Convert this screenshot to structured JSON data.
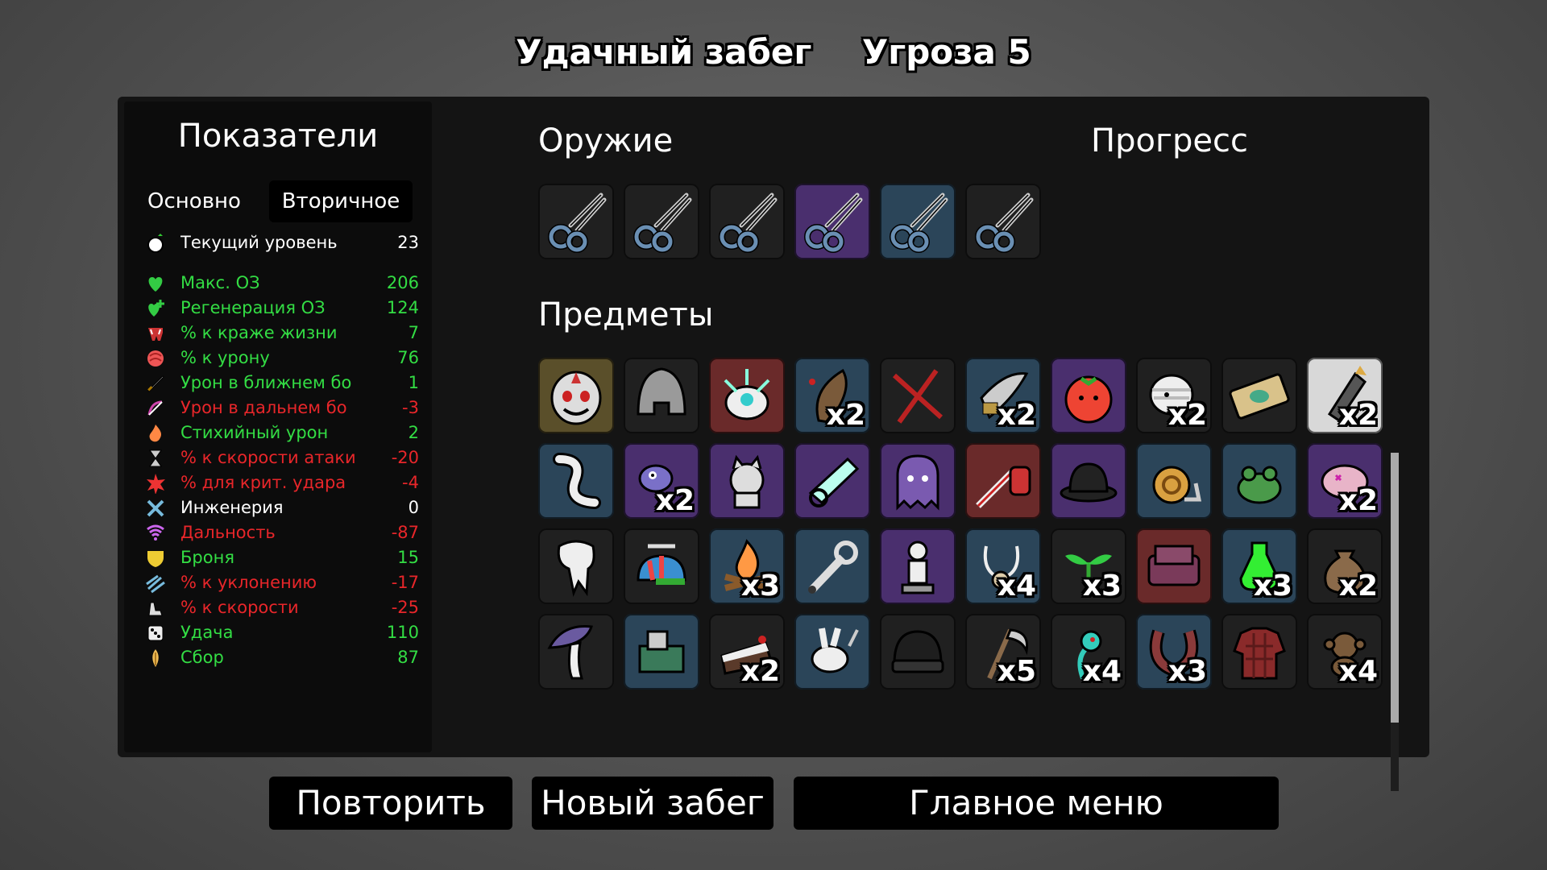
{
  "header": {
    "run_title": "Удачный забег",
    "danger": "Угроза 5"
  },
  "stats": {
    "title": "Показатели",
    "tabs": [
      {
        "label": "Основно"
      },
      {
        "label": "Вторичное"
      }
    ],
    "rows": [
      {
        "label": "Текущий уровень",
        "value": "23",
        "color": "#ffffff",
        "icon": "level-icon"
      },
      {
        "label": "Макс. ОЗ",
        "value": "206",
        "color": "#33dd44",
        "icon": "heart-icon"
      },
      {
        "label": "Регенерация ОЗ",
        "value": "124",
        "color": "#33dd44",
        "icon": "regen-icon"
      },
      {
        "label": "% к краже жизни",
        "value": "7",
        "color": "#33dd44",
        "icon": "lifesteal-icon"
      },
      {
        "label": "% к урону",
        "value": "76",
        "color": "#33dd44",
        "icon": "damage-icon"
      },
      {
        "label": "Урон в ближнем бо",
        "value": "1",
        "color": "#33dd44",
        "icon": "melee-icon"
      },
      {
        "label": "Урон в дальнем бо",
        "value": "-3",
        "color": "#e8262a",
        "icon": "ranged-icon"
      },
      {
        "label": "Стихийный урон",
        "value": "2",
        "color": "#33dd44",
        "icon": "elemental-icon"
      },
      {
        "label": "% к скорости атаки",
        "value": "-20",
        "color": "#e8262a",
        "icon": "attack-speed-icon"
      },
      {
        "label": "% для крит. удара",
        "value": "-4",
        "color": "#e8262a",
        "icon": "crit-icon"
      },
      {
        "label": "Инженерия",
        "value": "0",
        "color": "#ffffff",
        "icon": "engineering-icon"
      },
      {
        "label": "Дальность",
        "value": "-87",
        "color": "#e8262a",
        "icon": "range-icon"
      },
      {
        "label": "Броня",
        "value": "15",
        "color": "#33dd44",
        "icon": "armor-icon"
      },
      {
        "label": "% к уклонению",
        "value": "-17",
        "color": "#e8262a",
        "icon": "dodge-icon"
      },
      {
        "label": "% к скорости",
        "value": "-25",
        "color": "#e8262a",
        "icon": "speed-icon"
      },
      {
        "label": "Удача",
        "value": "110",
        "color": "#33dd44",
        "icon": "luck-icon"
      },
      {
        "label": "Сбор",
        "value": "87",
        "color": "#33dd44",
        "icon": "harvesting-icon"
      }
    ]
  },
  "weapons": {
    "title": "Оружие",
    "slots": [
      {
        "tier": "t0",
        "icon": "scissors-icon"
      },
      {
        "tier": "t0",
        "icon": "scissors-icon"
      },
      {
        "tier": "t0",
        "icon": "scissors-icon"
      },
      {
        "tier": "t2",
        "icon": "scissors-icon"
      },
      {
        "tier": "t1",
        "icon": "scissors-icon"
      },
      {
        "tier": "t0",
        "icon": "scissors-icon"
      }
    ]
  },
  "progress": {
    "title": "Прогресс"
  },
  "items": {
    "title": "Предметы",
    "slots": [
      {
        "tier": "tg",
        "icon": "knight-mask-icon",
        "mult": ""
      },
      {
        "tier": "t0",
        "icon": "helmet-icon",
        "mult": ""
      },
      {
        "tier": "t3",
        "icon": "spiky-creature-icon",
        "mult": ""
      },
      {
        "tier": "t1",
        "icon": "cocoon-icon",
        "mult": "x2"
      },
      {
        "tier": "t0",
        "icon": "red-cross-icon",
        "mult": ""
      },
      {
        "tier": "t1",
        "icon": "blade-icon",
        "mult": "x2"
      },
      {
        "tier": "t2",
        "icon": "tomato-icon",
        "mult": ""
      },
      {
        "tier": "t0",
        "icon": "bandaged-head-icon",
        "mult": "x2"
      },
      {
        "tier": "t0",
        "icon": "banknote-icon",
        "mult": ""
      },
      {
        "tier": "tw",
        "icon": "missile-icon",
        "mult": "x2"
      },
      {
        "tier": "t1",
        "icon": "worm-icon",
        "mult": ""
      },
      {
        "tier": "t2",
        "icon": "alien-icon",
        "mult": "x2"
      },
      {
        "tier": "t2",
        "icon": "cat-icon",
        "mult": ""
      },
      {
        "tier": "t2",
        "icon": "cannon-icon",
        "mult": ""
      },
      {
        "tier": "t2",
        "icon": "ghost-icon",
        "mult": ""
      },
      {
        "tier": "t3",
        "icon": "syringe-icon",
        "mult": ""
      },
      {
        "tier": "t2",
        "icon": "bowler-hat-icon",
        "mult": ""
      },
      {
        "tier": "t1",
        "icon": "snail-icon",
        "mult": ""
      },
      {
        "tier": "t1",
        "icon": "frog-icon",
        "mult": ""
      },
      {
        "tier": "t2",
        "icon": "brain-icon",
        "mult": "x2"
      },
      {
        "tier": "t0",
        "icon": "tooth-icon",
        "mult": ""
      },
      {
        "tier": "t0",
        "icon": "propeller-cap-icon",
        "mult": ""
      },
      {
        "tier": "t1",
        "icon": "campfire-icon",
        "mult": "x3"
      },
      {
        "tier": "t1",
        "icon": "wrench-icon",
        "mult": ""
      },
      {
        "tier": "t2",
        "icon": "statue-icon",
        "mult": ""
      },
      {
        "tier": "t1",
        "icon": "necklace-icon",
        "mult": "x4"
      },
      {
        "tier": "t0",
        "icon": "sprout-icon",
        "mult": "x3"
      },
      {
        "tier": "t3",
        "icon": "couch-icon",
        "mult": ""
      },
      {
        "tier": "t1",
        "icon": "potion-icon",
        "mult": "x3"
      },
      {
        "tier": "t0",
        "icon": "sack-icon",
        "mult": "x2"
      },
      {
        "tier": "t0",
        "icon": "mushroom-icon",
        "mult": ""
      },
      {
        "tier": "t1",
        "icon": "machine-icon",
        "mult": ""
      },
      {
        "tier": "t0",
        "icon": "cake-icon",
        "mult": "x2"
      },
      {
        "tier": "t1",
        "icon": "rabbit-icon",
        "mult": ""
      },
      {
        "tier": "t0",
        "icon": "beanie-icon",
        "mult": ""
      },
      {
        "tier": "t0",
        "icon": "scythe-icon",
        "mult": "x5"
      },
      {
        "tier": "t0",
        "icon": "alien-plant-icon",
        "mult": "x4"
      },
      {
        "tier": "t1",
        "icon": "horseshoe-icon",
        "mult": "x3"
      },
      {
        "tier": "t0",
        "icon": "plaid-shirt-icon",
        "mult": ""
      },
      {
        "tier": "t0",
        "icon": "monkey-icon",
        "mult": "x4"
      }
    ]
  },
  "buttons": {
    "retry": "Повторить",
    "new_run": "Новый забег",
    "main_menu": "Главное меню"
  }
}
